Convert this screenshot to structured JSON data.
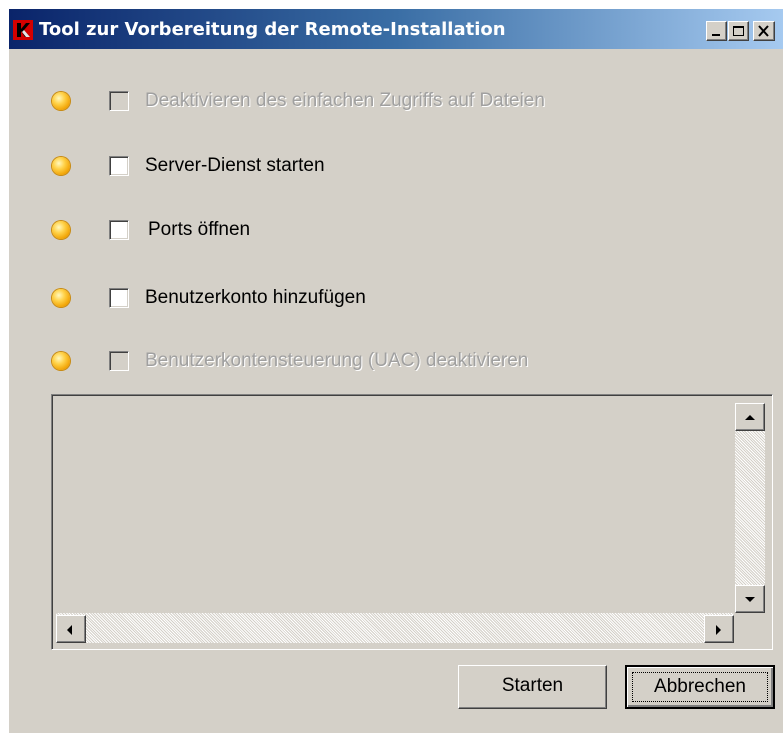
{
  "window": {
    "title": "Tool zur Vorbereitung der Remote-Installation",
    "icon": "kaspersky-k-icon",
    "controls": [
      "minimize-icon",
      "maximize-icon",
      "close-icon"
    ]
  },
  "options": [
    {
      "label": "Deaktivieren des einfachen Zugriffs auf Dateien",
      "enabled": false,
      "checked": false,
      "indicator": "yellow"
    },
    {
      "label": "Server-Dienst starten",
      "enabled": true,
      "checked": false,
      "indicator": "yellow"
    },
    {
      "label": "Ports öffnen",
      "enabled": true,
      "checked": false,
      "indicator": "yellow"
    },
    {
      "label": "Benutzerkonto hinzufügen",
      "enabled": true,
      "checked": false,
      "indicator": "yellow"
    },
    {
      "label": "Benutzerkontensteuerung (UAC) deaktivieren",
      "enabled": false,
      "checked": false,
      "indicator": "yellow"
    }
  ],
  "log": {
    "content": ""
  },
  "buttons": {
    "start_label": "Starten",
    "cancel_label": "Abbrechen"
  },
  "colors": {
    "titlebar_start": "#0a246a",
    "titlebar_end": "#a6caf0",
    "face": "#d4d0c8",
    "indicator": "#f0a000",
    "disabled_text": "#a0a0a0"
  }
}
